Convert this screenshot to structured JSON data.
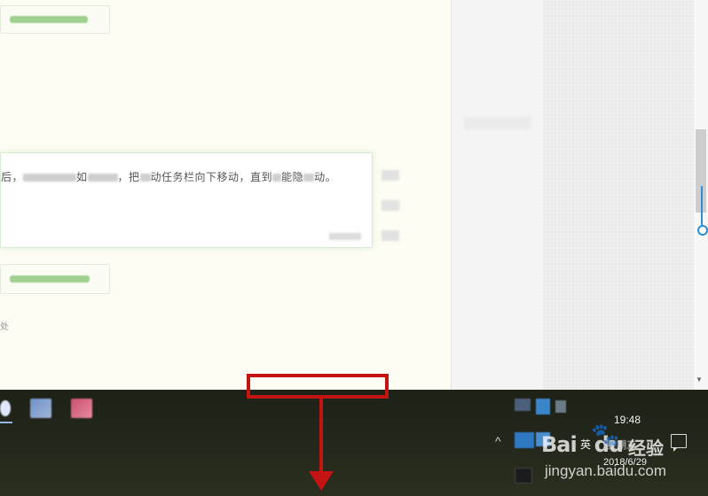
{
  "content": {
    "msg_prefix": "后，",
    "msg_mid_1": "如",
    "msg_mid_2": "，把",
    "msg_mid_3": "动任务栏向下移动，直到",
    "msg_mid_4": "能隐",
    "msg_mid_5": "动。",
    "addr_text": "处"
  },
  "taskbar": {
    "clock_time": "19:48",
    "language": "英",
    "weekday": "星期五",
    "clock_date": "2018/6/29"
  },
  "watermark": {
    "logo": "Bai",
    "logo_suffix": "du",
    "cn": "经验",
    "url": "jingyan.baidu.com"
  },
  "icons": {
    "up": "chevron-up-icon",
    "notify": "action-center-icon",
    "arrow": "down-arrow-icon"
  },
  "colors": {
    "annotation": "#c41313",
    "accent": "#2c8fd6"
  }
}
